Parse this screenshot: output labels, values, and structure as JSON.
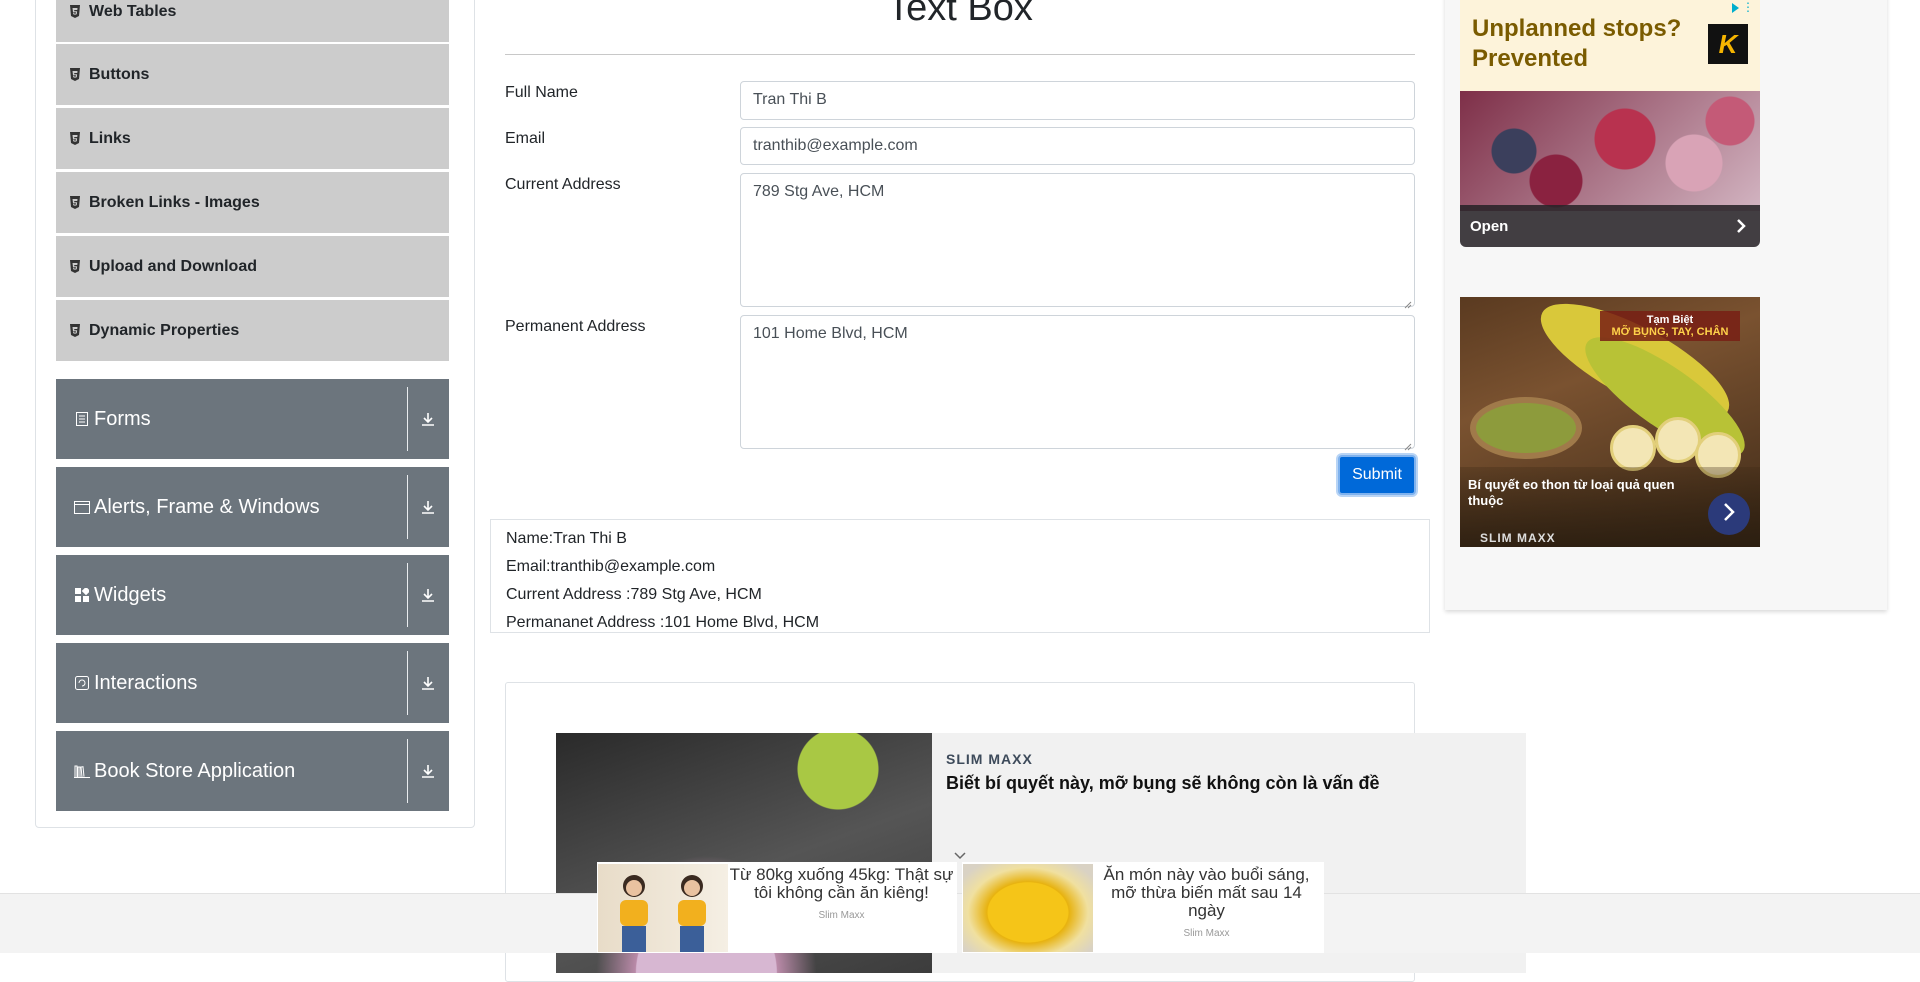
{
  "sidebar": {
    "elements_items": [
      {
        "label": "Web Tables"
      },
      {
        "label": "Buttons"
      },
      {
        "label": "Links"
      },
      {
        "label": "Broken Links - Images"
      },
      {
        "label": "Upload and Download"
      },
      {
        "label": "Dynamic Properties"
      }
    ],
    "groups": [
      {
        "label": "Forms"
      },
      {
        "label": "Alerts, Frame & Windows"
      },
      {
        "label": "Widgets"
      },
      {
        "label": "Interactions"
      },
      {
        "label": "Book Store Application"
      }
    ]
  },
  "main": {
    "title": "Text Box",
    "form": {
      "full_name_label": "Full Name",
      "full_name_value": "Tran Thi B",
      "email_label": "Email",
      "email_value": "tranthib@example.com",
      "current_address_label": "Current Address",
      "current_address_value": "789 Stg Ave, HCM",
      "permanent_address_label": "Permanent Address",
      "permanent_address_value": "101 Home Blvd, HCM",
      "submit_label": "Submit"
    },
    "output": {
      "name": "Name:Tran Thi B",
      "email": "Email:tranthib@example.com",
      "current_address": "Current Address :789 Stg Ave, HCM",
      "permanent_address": "Permananet Address :101 Home Blvd, HCM"
    }
  },
  "ads": {
    "right_top": {
      "headline": "Unplanned stops? Prevented",
      "logo_letter": "K",
      "cta": "Open"
    },
    "right_bottom": {
      "tag_line1": "Tạm Biệt",
      "tag_line2": "MỠ BỤNG, TAY, CHÂN",
      "caption": "Bí quyết eo thon từ loại quả quen thuộc",
      "brand": "SLIM MAXX"
    },
    "middle": {
      "brand": "SLIM MAXX",
      "title": "Biết bí quyết này, mỡ bụng sẽ không còn là vấn đề"
    },
    "bottom": [
      {
        "text": "Từ 80kg xuống 45kg: Thật sự tôi không cần ăn kiêng!",
        "source": "Slim Maxx"
      },
      {
        "text": "Ăn món này vào buổi sáng, mỡ thừa biến mất sau 14 ngày",
        "source": "Slim Maxx"
      }
    ]
  },
  "colors": {
    "accent": "#007bff",
    "submit": "#0069d9",
    "group_bg": "#6c757d",
    "sub_item_bg": "#cccccc"
  }
}
